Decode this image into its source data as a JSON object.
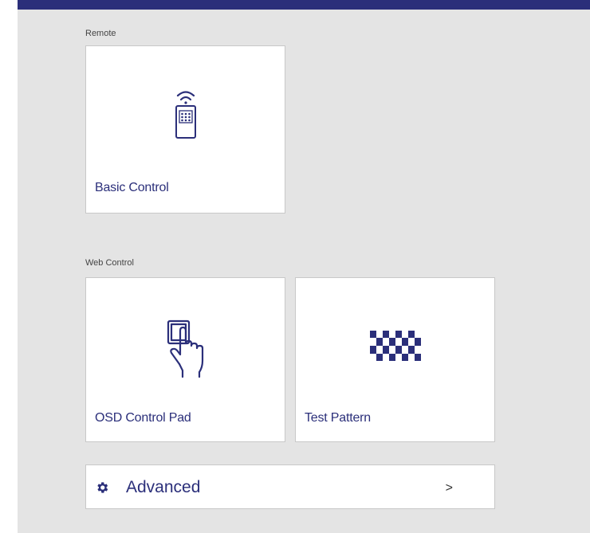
{
  "sections": {
    "remote": {
      "label": "Remote",
      "tiles": [
        {
          "label": "Basic Control",
          "icon": "remote-control-icon"
        }
      ]
    },
    "web_control": {
      "label": "Web Control",
      "tiles": [
        {
          "label": "OSD Control Pad",
          "icon": "touch-pad-icon"
        },
        {
          "label": "Test Pattern",
          "icon": "checkerboard-icon"
        }
      ]
    }
  },
  "advanced": {
    "label": "Advanced",
    "icon": "gear-icon",
    "chevron": ">"
  },
  "colors": {
    "accent": "#2b2f7a",
    "panel_bg": "#e4e4e4",
    "tile_bg": "#ffffff"
  }
}
